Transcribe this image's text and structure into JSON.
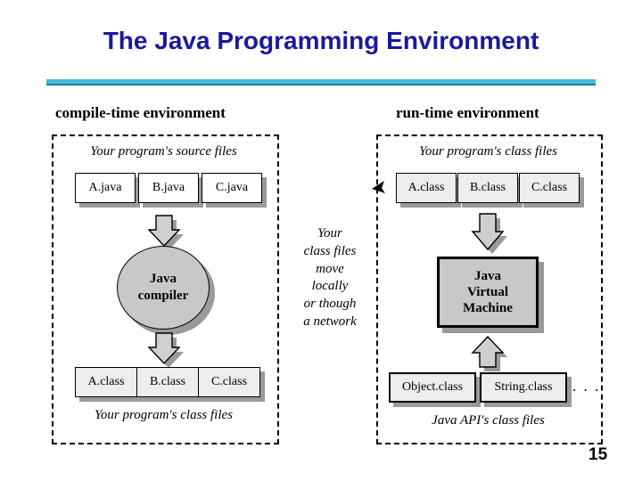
{
  "slide": {
    "title": "The Java Programming Environment",
    "page_number": "15",
    "title_color": "#1a1a9c",
    "rule_color": "#44bcd8"
  },
  "compile_side": {
    "heading": "compile-time environment",
    "top_caption": "Your program's source files",
    "source_files": [
      "A.java",
      "B.java",
      "C.java"
    ],
    "compiler": {
      "line1": "Java",
      "line2": "compiler"
    },
    "class_files": [
      "A.class",
      "B.class",
      "C.class"
    ],
    "bottom_caption": "Your program's class files"
  },
  "middle_note": {
    "lines": [
      "Your",
      "class files",
      "move",
      "locally",
      "or though",
      "a network"
    ]
  },
  "runtime_side": {
    "heading": "run-time environment",
    "top_caption": "Your program's class files",
    "class_files": [
      "A.class",
      "B.class",
      "C.class"
    ],
    "jvm": {
      "line1": "Java",
      "line2": "Virtual",
      "line3": "Machine"
    },
    "api_files": [
      "Object.class",
      "String.class"
    ],
    "api_ellipsis": ". . .",
    "bottom_caption": "Java API's class files"
  }
}
